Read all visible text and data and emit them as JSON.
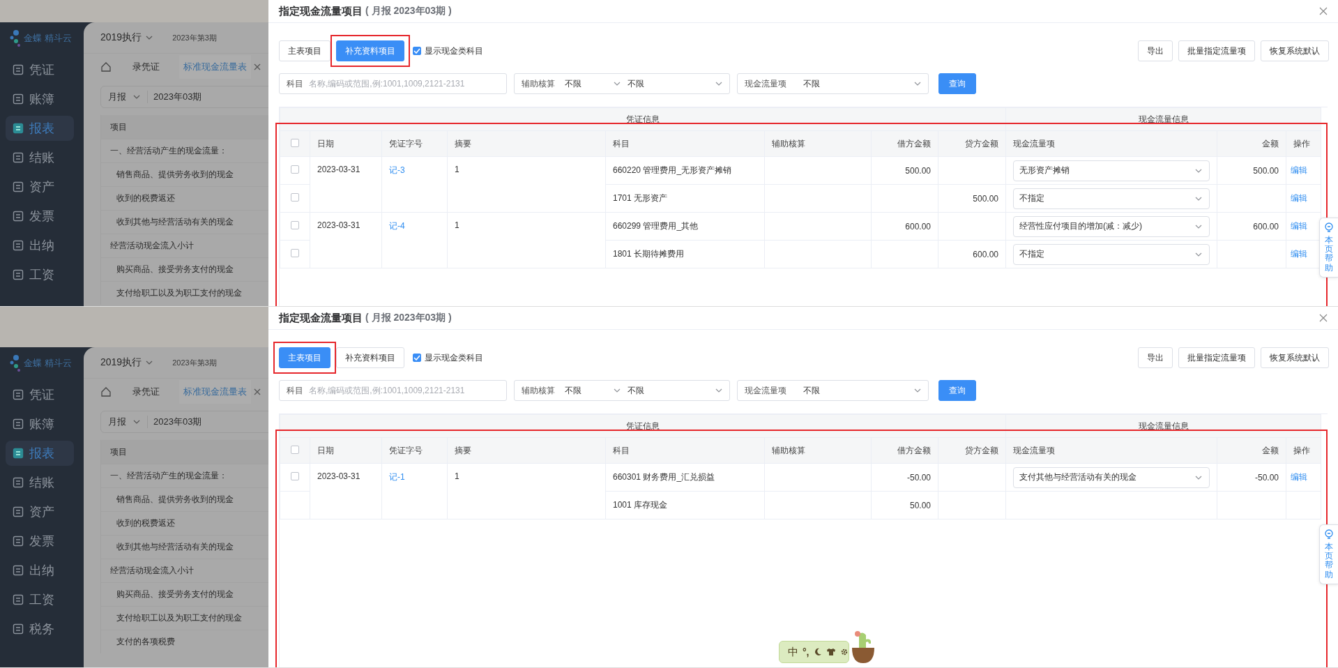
{
  "panels": [
    {
      "app": {
        "logo": "金蝶 精斗云",
        "book": "2019执行",
        "period": "2023年第3期",
        "nav": [
          {
            "label": "凭证",
            "selected": false
          },
          {
            "label": "账簿",
            "selected": false
          },
          {
            "label": "报表",
            "selected": true
          },
          {
            "label": "结账",
            "selected": false
          },
          {
            "label": "资产",
            "selected": false
          },
          {
            "label": "发票",
            "selected": false
          },
          {
            "label": "出纳",
            "selected": false
          },
          {
            "label": "工资",
            "selected": false
          }
        ],
        "tabs": [
          {
            "label": "录凭证",
            "selected": false
          },
          {
            "label": "标准现金流量表",
            "selected": true
          }
        ],
        "report_type": "月报",
        "report_period": "2023年03期",
        "report_header": "项目",
        "report_rows": [
          {
            "label": "一、经营活动产生的现金流量：",
            "kind": "section"
          },
          {
            "label": "销售商品、提供劳务收到的现金",
            "kind": "item"
          },
          {
            "label": "收到的税费返还",
            "kind": "item"
          },
          {
            "label": "收到其他与经营活动有关的现金",
            "kind": "item"
          },
          {
            "label": "经营活动现金流入小计",
            "kind": "section"
          },
          {
            "label": "购买商品、接受劳务支付的现金",
            "kind": "item"
          },
          {
            "label": "支付给职工以及为职工支付的现金",
            "kind": "item"
          }
        ]
      },
      "dialog": {
        "title": "指定现金流量项目",
        "subtitle": "( 月报 2023年03期 )",
        "tabs": [
          {
            "label": "主表项目",
            "selected": false,
            "highlighted": false
          },
          {
            "label": "补充资料项目",
            "selected": true,
            "highlighted": true
          }
        ],
        "cash_only": {
          "label": "显示现金类科目",
          "checked": true
        },
        "actions": [
          "导出",
          "批量指定流量项",
          "恢复系统默认"
        ],
        "subject": {
          "label": "科目",
          "placeholder": "名称,编码或范围,例:1001,1009,2121-2131"
        },
        "aux": {
          "label": "辅助核算",
          "type": "不限",
          "value": "不限"
        },
        "cash_item": {
          "label": "现金流量项",
          "value": "不限"
        },
        "query": "查询",
        "table": {
          "highlighted": true,
          "all_checked": false,
          "groups": [
            "凭证信息",
            "现金流量信息"
          ],
          "columns": [
            "日期",
            "凭证字号",
            "摘要",
            "科目",
            "辅助核算",
            "借方金额",
            "贷方金额",
            "现金流量项",
            "金额",
            "操作"
          ],
          "vouchers": [
            {
              "date": "2023-03-31",
              "number": "记-3",
              "summary": "1",
              "entries": [
                {
                  "checked": false,
                  "account": "660220 管理费用_无形资产摊销",
                  "debit": "500.00",
                  "cash_item": "无形资产摊销",
                  "amount": "500.00",
                  "action": "编辑"
                },
                {
                  "checked": false,
                  "account": "1701 无形资产",
                  "credit": "500.00",
                  "cash_item": "不指定",
                  "action": "编辑"
                }
              ]
            },
            {
              "date": "2023-03-31",
              "number": "记-4",
              "summary": "1",
              "entries": [
                {
                  "checked": false,
                  "account": "660299 管理费用_其他",
                  "debit": "600.00",
                  "cash_item": "经营性应付项目的增加(减：减少)",
                  "amount": "600.00",
                  "action": "编辑"
                },
                {
                  "checked": false,
                  "account": "1801 长期待摊费用",
                  "credit": "600.00",
                  "cash_item": "不指定",
                  "action": "编辑"
                }
              ]
            }
          ]
        },
        "help": "本页帮助"
      }
    },
    {
      "app": {
        "logo": "金蝶 精斗云",
        "book": "2019执行",
        "period": "2023年第3期",
        "nav": [
          {
            "label": "凭证",
            "selected": false
          },
          {
            "label": "账簿",
            "selected": false
          },
          {
            "label": "报表",
            "selected": true
          },
          {
            "label": "结账",
            "selected": false
          },
          {
            "label": "资产",
            "selected": false
          },
          {
            "label": "发票",
            "selected": false
          },
          {
            "label": "出纳",
            "selected": false
          },
          {
            "label": "工资",
            "selected": false
          },
          {
            "label": "税务",
            "selected": false
          }
        ],
        "tabs": [
          {
            "label": "录凭证",
            "selected": false
          },
          {
            "label": "标准现金流量表",
            "selected": true
          }
        ],
        "report_type": "月报",
        "report_period": "2023年03期",
        "report_header": "项目",
        "report_rows": [
          {
            "label": "一、经营活动产生的现金流量：",
            "kind": "section"
          },
          {
            "label": "销售商品、提供劳务收到的现金",
            "kind": "item"
          },
          {
            "label": "收到的税费返还",
            "kind": "item"
          },
          {
            "label": "收到其他与经营活动有关的现金",
            "kind": "item"
          },
          {
            "label": "经营活动现金流入小计",
            "kind": "section"
          },
          {
            "label": "购买商品、接受劳务支付的现金",
            "kind": "item"
          },
          {
            "label": "支付给职工以及为职工支付的现金",
            "kind": "item"
          },
          {
            "label": "支付的各项税费",
            "kind": "item"
          }
        ]
      },
      "dialog": {
        "title": "指定现金流量项目",
        "subtitle": "( 月报 2023年03期 )",
        "tabs": [
          {
            "label": "主表项目",
            "selected": true,
            "highlighted": true
          },
          {
            "label": "补充资料项目",
            "selected": false,
            "highlighted": false
          }
        ],
        "cash_only": {
          "label": "显示现金类科目",
          "checked": true
        },
        "actions": [
          "导出",
          "批量指定流量项",
          "恢复系统默认"
        ],
        "subject": {
          "label": "科目",
          "placeholder": "名称,编码或范围,例:1001,1009,2121-2131"
        },
        "aux": {
          "label": "辅助核算",
          "type": "不限",
          "value": "不限"
        },
        "cash_item": {
          "label": "现金流量项",
          "value": "不限"
        },
        "query": "查询",
        "table": {
          "highlighted": true,
          "all_checked": false,
          "groups": [
            "凭证信息",
            "现金流量信息"
          ],
          "columns": [
            "日期",
            "凭证字号",
            "摘要",
            "科目",
            "辅助核算",
            "借方金额",
            "贷方金额",
            "现金流量项",
            "金额",
            "操作"
          ],
          "vouchers": [
            {
              "date": "2023-03-31",
              "number": "记-1",
              "summary": "1",
              "entries": [
                {
                  "checked": false,
                  "account": "660301 财务费用_汇兑损益",
                  "debit": "-50.00",
                  "cash_item": "支付其他与经营活动有关的现金",
                  "amount": "-50.00",
                  "action": "编辑"
                },
                {
                  "account": "1001 库存现金",
                  "debit": "50.00"
                }
              ]
            }
          ]
        },
        "help": "本页帮助",
        "ime": {
          "mode": "中",
          "punctuation": "°,"
        }
      }
    }
  ]
}
